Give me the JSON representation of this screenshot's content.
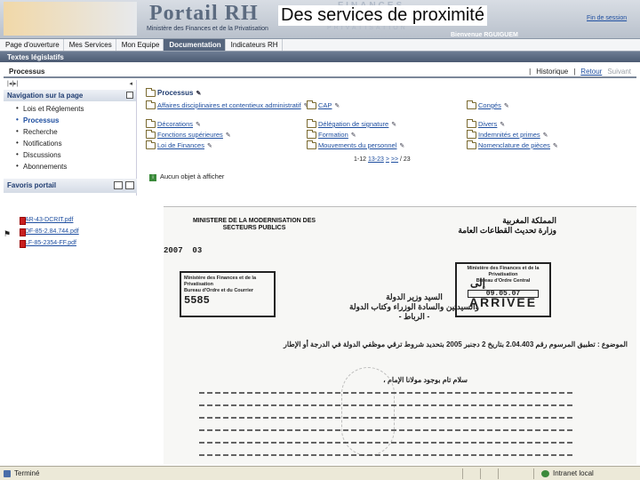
{
  "banner": {
    "app_title": "Portail RH",
    "ministry_line1": "Ministère des Finances et de la Privatisation",
    "watermark_top": "FINANCES",
    "watermark_bottom": "PRIVATISATION",
    "slide_title": "Des services de proximité",
    "logout": "Fin de session",
    "welcome": "Bienvenue RGUIGUEM"
  },
  "menu": {
    "items": [
      "Page d'ouverture",
      "Mes Services",
      "Mon Equipe",
      "Documentation",
      "Indicateurs RH"
    ],
    "active_index": 3
  },
  "subbar": {
    "label": "Textes législatifs"
  },
  "crumb": {
    "label": "Processus",
    "history": "Historique",
    "back": "Retour",
    "next": "Suivant"
  },
  "sidebar": {
    "tools_left": "|◂|▸|",
    "tools_right": "◂",
    "nav_title": "Navigation sur la page",
    "items": [
      "Lois et Réglements",
      "Processus",
      "Recherche",
      "Notifications",
      "Discussions",
      "Abonnements"
    ],
    "selected_index": 1,
    "fav_title": "Favoris portail"
  },
  "content": {
    "title": "Processus",
    "col1": [
      "Affaires disciplinaires et contentieux administratif",
      "Décorations",
      "Fonctions supérieures",
      "Loi de Finances"
    ],
    "col2": [
      "CAP",
      "Délégation de signature",
      "Formation",
      "Mouvements du personnel"
    ],
    "col3": [
      "Congés",
      "Divers",
      "Indemnités et primes",
      "Nomenclature de pièces"
    ],
    "pager": {
      "range": "1-12",
      "next_range": "13-23",
      "next": ">",
      "last": ">>",
      "total": "/ 23"
    },
    "no_object": "Aucun objet à afficher"
  },
  "files": [
    "AR-43-DCRIT.pdf",
    "DF-85-2.84.744.pdf",
    "LF-85-2354-FF.pdf"
  ],
  "document": {
    "head_fr": "MINISTERE DE LA MODERNISATION DES SECTEURS PUBLICS",
    "head_ar": "المملكة المغربية\nوزارة تحديث القطاعات العامة",
    "date_num": "2007",
    "date_day": "03",
    "stamp_left_title": "Ministère des Finances et de la Privatisation",
    "stamp_left_sub": "Bureau d'Ordre et du Courrier",
    "stamp_left_num": "5585",
    "stamp_right_title": "Ministère des Finances et de la Privatisation",
    "stamp_right_sub": "Bureau d'Ordre Central",
    "stamp_right_date": "09.05.07",
    "stamp_right_status": "ARRIVEE",
    "to": "إلى",
    "addressee": "السيد وزير الدولة\nوالسيدتين والسادة الوزراء وكتاب الدولة\n- الرباط -",
    "subject": "الموضوع : تطبيق المرسوم رقم 2.04.403 بتاريخ 2 دجنبر 2005 بتحديد شروط ترقي موظفي الدولة في الدرجة أو الإطار",
    "greeting": "سلام تام بوجود مولانا الإمام ،"
  },
  "status": {
    "left": "Terminé",
    "zone": "Intranet local"
  }
}
